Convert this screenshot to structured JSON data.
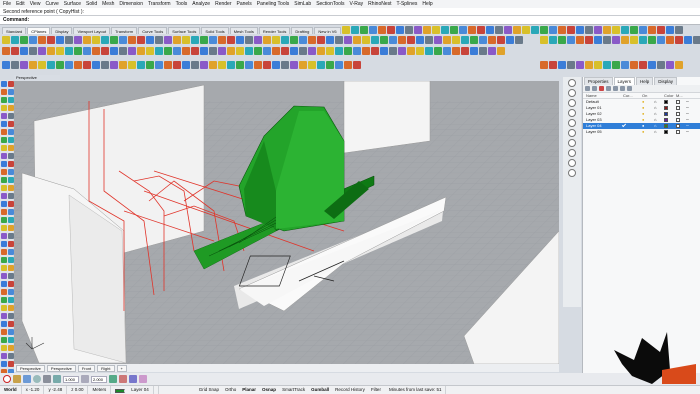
{
  "menu": [
    "File",
    "Edit",
    "View",
    "Curve",
    "Surface",
    "Solid",
    "Mesh",
    "Dimension",
    "Transform",
    "Tools",
    "Analyze",
    "Render",
    "Panels",
    "Paneling Tools",
    "SimLab",
    "SectionTools",
    "V-Ray",
    "RhinoNest",
    "T-Splines",
    "Help"
  ],
  "command": {
    "history": "Second reference point ( CopyHist ):",
    "prompt": "Command:"
  },
  "toolbar_tabs": [
    {
      "label": "Standard",
      "active": false
    },
    {
      "label": "CPlanes",
      "active": true
    },
    {
      "label": "Display",
      "active": false
    },
    {
      "label": "Viewport Layout",
      "active": false
    },
    {
      "label": "Transform",
      "active": false
    },
    {
      "label": "Curve Tools",
      "active": false
    },
    {
      "label": "Surface Tools",
      "active": false
    },
    {
      "label": "Solid Tools",
      "active": false
    },
    {
      "label": "Mesh Tools",
      "active": false
    },
    {
      "label": "Render Tools",
      "active": false
    },
    {
      "label": "Drafting",
      "active": false
    },
    {
      "label": "New in V6",
      "active": false
    }
  ],
  "viewport": {
    "title": "Perspective",
    "tabs": [
      "Perspective",
      "Perspective",
      "Front",
      "Right",
      "+"
    ]
  },
  "panel": {
    "tabs": [
      {
        "label": "Properties",
        "active": false
      },
      {
        "label": "Layers",
        "active": true
      },
      {
        "label": "Help",
        "active": false
      },
      {
        "label": "Display",
        "active": false
      }
    ],
    "columns": {
      "name": "Name",
      "current": "Cur...",
      "on": "On",
      "lock": "",
      "color": "Color",
      "material": "M...",
      "linetype": ""
    },
    "layers": [
      {
        "name": "Default",
        "color": "#000000",
        "selected": false,
        "current": false
      },
      {
        "name": "Layer 01",
        "color": "#8b1a1a",
        "selected": false,
        "current": false
      },
      {
        "name": "Layer 02",
        "color": "#1c3a9e",
        "selected": false,
        "current": false
      },
      {
        "name": "Layer 03",
        "color": "#6a1aa0",
        "selected": false,
        "current": false
      },
      {
        "name": "Layer 04",
        "color": "#1b8a2a",
        "selected": true,
        "current": true
      },
      {
        "name": "Layer 05",
        "color": "#000000",
        "selected": false,
        "current": false
      }
    ]
  },
  "status": {
    "cplane": "World",
    "x": "x -1.20",
    "y": "y -2.48",
    "z": "z 0.00",
    "units": "Meters",
    "layer": "Layer 04",
    "toggles": [
      "Grid Snap",
      "Ortho",
      "Planar",
      "Osnap",
      "SmartTrack",
      "Gumball",
      "Record History",
      "Filter"
    ],
    "toggles_active": [
      "Planar",
      "Osnap",
      "Gumball"
    ],
    "save_info": "Minutes from last save: 51"
  },
  "osnap": {
    "value1": "1.000",
    "value2": "2.000"
  },
  "colors": {
    "accent": "#2f7ed8",
    "model": "#1e8a22",
    "section": "#e0342a",
    "viewport_bg": "#a3a6aa"
  }
}
